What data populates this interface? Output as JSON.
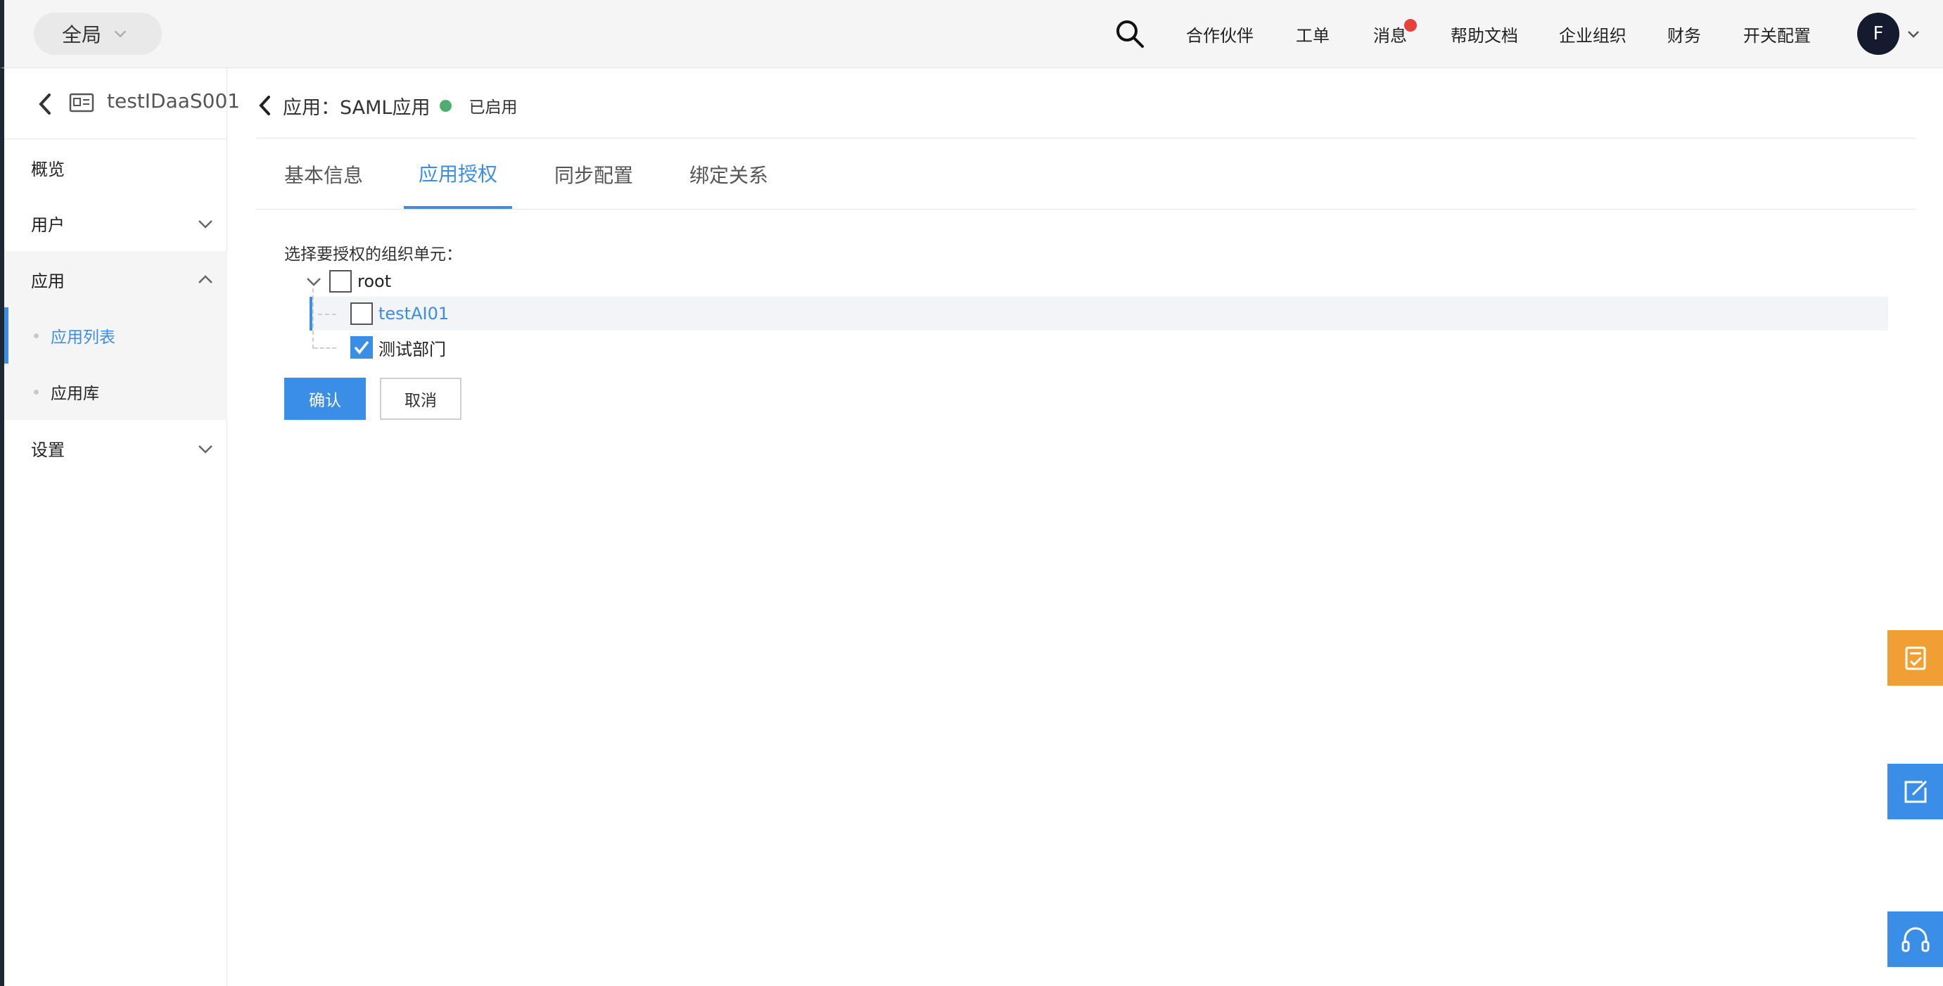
{
  "header": {
    "scope": "全局",
    "nav": [
      "合作伙伴",
      "工单",
      "消息",
      "帮助文档",
      "企业组织",
      "财务",
      "开关配置"
    ],
    "avatar_letter": "F"
  },
  "sidebar": {
    "instance_title": "testIDaaS001",
    "items": {
      "overview": "概览",
      "users": "用户",
      "apps": "应用",
      "app_list": "应用列表",
      "app_library": "应用库",
      "settings": "设置"
    }
  },
  "page": {
    "breadcrumb_prefix": "应用：",
    "app_name": "SAML应用",
    "status": "已启用",
    "tabs": [
      "基本信息",
      "应用授权",
      "同步配置",
      "绑定关系"
    ],
    "active_tab": "应用授权",
    "form_label": "选择要授权的组织单元：",
    "tree": {
      "root": "root",
      "children": [
        {
          "label": "testAI01",
          "checked": false
        },
        {
          "label": "测试部门",
          "checked": true
        }
      ]
    },
    "confirm": "确认",
    "cancel": "取消"
  },
  "colors": {
    "accent": "#3a8ee6",
    "status_green": "#4caf6e",
    "badge_red": "#e8413c",
    "float_orange": "#f0a032",
    "float_blue": "#3a8ee6"
  }
}
